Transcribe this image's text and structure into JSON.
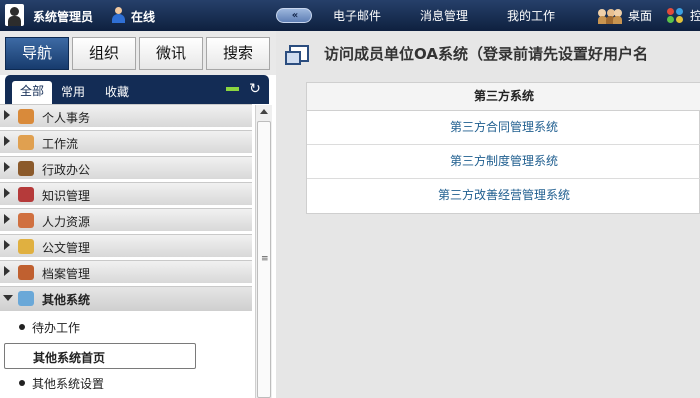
{
  "header": {
    "user_name": "系统管理员",
    "status": "在线",
    "collapse_glyph": "«",
    "nav": [
      "电子邮件",
      "消息管理",
      "我的工作"
    ],
    "desktop": "桌面",
    "apps_partial": "控"
  },
  "left": {
    "tabs": [
      "导航",
      "组织",
      "微讯",
      "搜索"
    ],
    "subtabs": [
      "全部",
      "常用",
      "收藏"
    ],
    "refresh_glyph": "↻",
    "menu": [
      {
        "label": "个人事务",
        "icon": "person-tasks-icon",
        "color": "#d98a3a"
      },
      {
        "label": "工作流",
        "icon": "workflow-icon",
        "color": "#e0a050"
      },
      {
        "label": "行政办公",
        "icon": "admin-office-icon",
        "color": "#8b5a2b"
      },
      {
        "label": "知识管理",
        "icon": "book-icon",
        "color": "#b53a3a"
      },
      {
        "label": "人力资源",
        "icon": "hr-icon",
        "color": "#d07040"
      },
      {
        "label": "公文管理",
        "icon": "document-icon",
        "color": "#e0b040"
      },
      {
        "label": "档案管理",
        "icon": "archive-icon",
        "color": "#c06030"
      },
      {
        "label": "其他系统",
        "icon": "other-systems-icon",
        "color": "#6aa8d8"
      }
    ],
    "submenu": [
      "待办工作",
      "其他系统首页",
      "其他系统设置"
    ],
    "scroll_grip": "≡"
  },
  "main": {
    "title": "访问成员单位OA系统（登录前请先设置好用户名",
    "table_header": "第三方系统",
    "rows": [
      "第三方合同管理系统",
      "第三方制度管理系统",
      "第三方改善经营管理系统"
    ]
  }
}
